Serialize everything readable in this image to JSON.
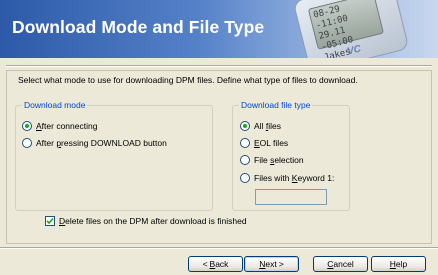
{
  "banner": {
    "title": "Download Mode and File Type",
    "screen_line1": "08-29 -11:00",
    "screen_line2": "29.11 -05:00",
    "screen_line3": "Jakes",
    "brand": "VC"
  },
  "instruction": "Select what mode to use for downloading DPM files. Define what type of files to download.",
  "download_mode": {
    "title": "Download mode",
    "options": [
      {
        "pre": "",
        "key": "A",
        "post": "fter connecting",
        "selected": true
      },
      {
        "pre": "After ",
        "key": "p",
        "post": "ressing DOWNLOAD button",
        "selected": false
      }
    ]
  },
  "file_type": {
    "title": "Download file type",
    "options": [
      {
        "pre": "All ",
        "key": "f",
        "post": "iles",
        "selected": true
      },
      {
        "pre": "",
        "key": "E",
        "post": "OL files",
        "selected": false
      },
      {
        "pre": "File ",
        "key": "s",
        "post": "election",
        "selected": false
      },
      {
        "pre": "Files with ",
        "key": "K",
        "post": "eyword 1:",
        "selected": false
      }
    ],
    "keyword_value": ""
  },
  "delete_checkbox": {
    "pre": "",
    "key": "D",
    "post": "elete files on the DPM after download is finished",
    "checked": true
  },
  "buttons": {
    "back": {
      "arrow": "<",
      "key": "B",
      "post": "ack"
    },
    "next": {
      "key": "N",
      "post": "ext",
      "arrow": ">"
    },
    "cancel": {
      "key": "C",
      "post": "ancel"
    },
    "help": {
      "key": "H",
      "post": "elp"
    }
  }
}
